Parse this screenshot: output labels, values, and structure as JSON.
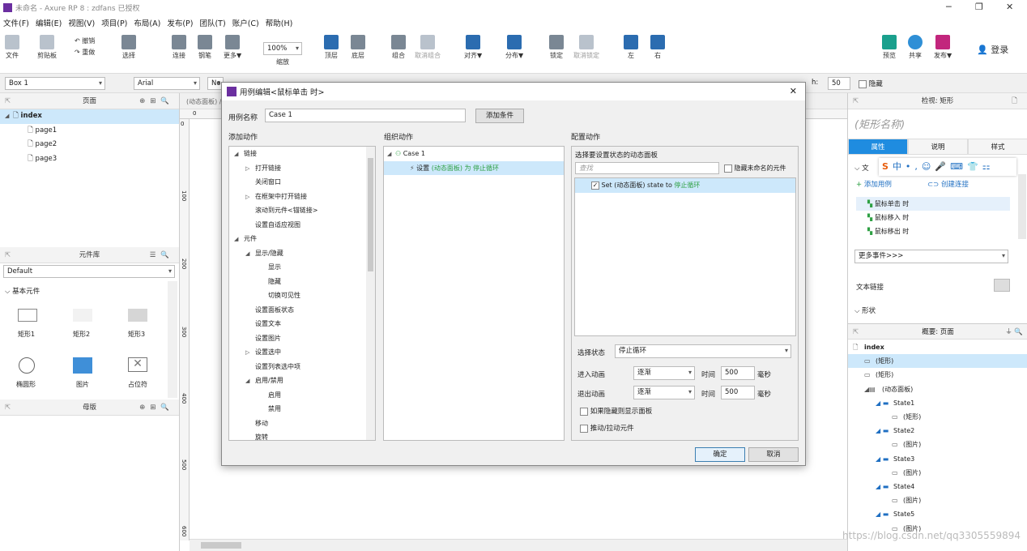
{
  "app": {
    "title": "未命名 - Axure RP 8 : zdfans 已授权"
  },
  "menu": [
    "文件(F)",
    "编辑(E)",
    "视图(V)",
    "项目(P)",
    "布局(A)",
    "发布(P)",
    "团队(T)",
    "账户(C)",
    "帮助(H)"
  ],
  "toolbar": {
    "file": "文件",
    "clipboard": "剪贴板",
    "undo": "撤销",
    "redo": "重做",
    "select": "选择",
    "connect": "连接",
    "pen": "钢笔",
    "more": "更多▼",
    "zoom_value": "100%",
    "zoom_label": "缩放",
    "top": "顶层",
    "bottom": "底层",
    "group": "组合",
    "ungroup": "取消组合",
    "align": "对齐▼",
    "distribute": "分布▼",
    "lock": "锁定",
    "unlock": "取消锁定",
    "left": "左",
    "right": "右",
    "preview": "预览",
    "share": "共享",
    "publish": "发布▼",
    "login": "登录"
  },
  "propbar": {
    "widget_name": "Box 1",
    "font": "Arial",
    "style": "No",
    "h_label": "h:",
    "h_value": "50",
    "hide_label": "隐藏"
  },
  "pages_panel": {
    "title": "页面",
    "items": [
      "index",
      "page1",
      "page2",
      "page3"
    ]
  },
  "library_panel": {
    "title": "元件库",
    "library": "Default",
    "group": "基本元件",
    "widgets": [
      "矩形1",
      "矩形2",
      "矩形3",
      "椭圆形",
      "图片",
      "占位符"
    ]
  },
  "masters_panel": {
    "title": "母版"
  },
  "canvas": {
    "tab": "(动态面板) /",
    "ruler_v": [
      "0",
      "100",
      "200",
      "300",
      "400",
      "500",
      "600"
    ],
    "ruler_h": [
      "0"
    ]
  },
  "dialog": {
    "title": "用例编辑<鼠标单击 时>",
    "case_name_label": "用例名称",
    "case_name_value": "Case 1",
    "add_condition": "添加条件",
    "col1_title": "添加动作",
    "col2_title": "组织动作",
    "col3_title": "配置动作",
    "actions": [
      {
        "text": "链接",
        "indent": 0,
        "arrow": "◢"
      },
      {
        "text": "打开链接",
        "indent": 1,
        "arrow": "▷"
      },
      {
        "text": "关闭窗口",
        "indent": 1,
        "arrow": ""
      },
      {
        "text": "在框架中打开链接",
        "indent": 1,
        "arrow": "▷"
      },
      {
        "text": "滚动到元件<锚链接>",
        "indent": 1,
        "arrow": ""
      },
      {
        "text": "设置自适应视图",
        "indent": 1,
        "arrow": ""
      },
      {
        "text": "元件",
        "indent": 0,
        "arrow": "◢"
      },
      {
        "text": "显示/隐藏",
        "indent": 1,
        "arrow": "◢"
      },
      {
        "text": "显示",
        "indent": 2,
        "arrow": ""
      },
      {
        "text": "隐藏",
        "indent": 2,
        "arrow": ""
      },
      {
        "text": "切换可见性",
        "indent": 2,
        "arrow": ""
      },
      {
        "text": "设置面板状态",
        "indent": 1,
        "arrow": ""
      },
      {
        "text": "设置文本",
        "indent": 1,
        "arrow": ""
      },
      {
        "text": "设置图片",
        "indent": 1,
        "arrow": ""
      },
      {
        "text": "设置选中",
        "indent": 1,
        "arrow": "▷"
      },
      {
        "text": "设置列表选中项",
        "indent": 1,
        "arrow": ""
      },
      {
        "text": "启用/禁用",
        "indent": 1,
        "arrow": "◢"
      },
      {
        "text": "启用",
        "indent": 2,
        "arrow": ""
      },
      {
        "text": "禁用",
        "indent": 2,
        "arrow": ""
      },
      {
        "text": "移动",
        "indent": 1,
        "arrow": ""
      },
      {
        "text": "旋转",
        "indent": 1,
        "arrow": ""
      }
    ],
    "organize": {
      "case": "Case 1",
      "action_prefix": "设置 ",
      "action_target": "(动态面板) 为 停止循环"
    },
    "config": {
      "panel_title": "选择要设置状态的动态面板",
      "search_placeholder": "查找",
      "hide_unnamed": "隐藏未命名的元件",
      "set_row_prefix": "Set (动态面板) state to ",
      "set_row_value": "停止循环",
      "select_state_label": "选择状态",
      "select_state_value": "停止循环",
      "enter_anim_label": "进入动画",
      "enter_anim_value": "逐渐",
      "exit_anim_label": "退出动画",
      "exit_anim_value": "逐渐",
      "time_label": "时间",
      "enter_time": "500",
      "exit_time": "500",
      "ms": "毫秒",
      "opt1": "如果隐藏则显示面板",
      "opt2": "推动/拉动元件"
    },
    "ok": "确定",
    "cancel": "取消"
  },
  "inspector": {
    "title": "检视: 矩形",
    "name_placeholder": "(矩形名称)",
    "tabs": [
      "属性",
      "说明",
      "样式"
    ],
    "text_label": "文",
    "add_case": "添加用例",
    "create_link": "创建连接",
    "events": [
      "鼠标单击 时",
      "鼠标移入 时",
      "鼠标移出 时"
    ],
    "more_events": "更多事件>>>",
    "text_link": "文本链接",
    "shape": "形状"
  },
  "outline": {
    "title": "概要: 页面",
    "rows": [
      {
        "text": "index",
        "level": 0
      },
      {
        "text": "(矩形)",
        "level": 1
      },
      {
        "text": "(矩形)",
        "level": 1
      },
      {
        "text": "(动态面板)",
        "level": 1
      },
      {
        "text": "State1",
        "level": 2
      },
      {
        "text": "(矩形)",
        "level": 3
      },
      {
        "text": "State2",
        "level": 2
      },
      {
        "text": "(图片)",
        "level": 3
      },
      {
        "text": "State3",
        "level": 2
      },
      {
        "text": "(图片)",
        "level": 3
      },
      {
        "text": "State4",
        "level": 2
      },
      {
        "text": "(图片)",
        "level": 3
      },
      {
        "text": "State5",
        "level": 2
      },
      {
        "text": "(图片)",
        "level": 3
      }
    ]
  },
  "watermark": "https://blog.csdn.net/qq3305559894"
}
